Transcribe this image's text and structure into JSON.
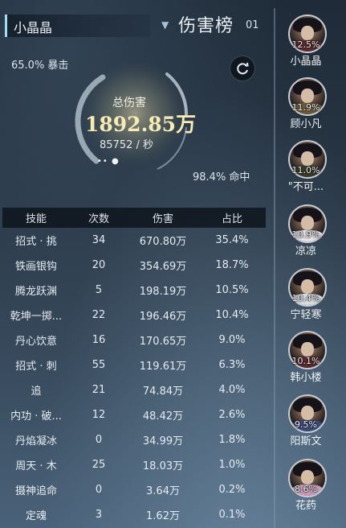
{
  "header": {
    "player_name": "小晶晶",
    "title": "伤害榜",
    "title_index": "01"
  },
  "summary": {
    "crit_rate": "65.0% 暴击",
    "total_label": "总伤害",
    "total_value": "1892.85万",
    "dps": "85752 / 秒",
    "hit_rate": "98.4% 命中"
  },
  "table": {
    "headers": [
      "技能",
      "次数",
      "伤害",
      "占比"
    ],
    "rows": [
      {
        "name": "招式 · 挑",
        "count": "34",
        "damage": "670.80万",
        "percent": "35.4%"
      },
      {
        "name": "铁画银钩",
        "count": "20",
        "damage": "354.69万",
        "percent": "18.7%"
      },
      {
        "name": "腾龙跃渊",
        "count": "5",
        "damage": "198.19万",
        "percent": "10.5%"
      },
      {
        "name": "乾坤一掷...",
        "count": "22",
        "damage": "196.46万",
        "percent": "10.4%"
      },
      {
        "name": "丹心饮意",
        "count": "16",
        "damage": "170.65万",
        "percent": "9.0%"
      },
      {
        "name": "招式 · 刺",
        "count": "55",
        "damage": "119.61万",
        "percent": "6.3%"
      },
      {
        "name": "追",
        "count": "21",
        "damage": "74.84万",
        "percent": "4.0%"
      },
      {
        "name": "内功 · 破...",
        "count": "12",
        "damage": "48.42万",
        "percent": "2.6%"
      },
      {
        "name": "丹焰凝冰",
        "count": "0",
        "damage": "34.99万",
        "percent": "1.8%"
      },
      {
        "name": "周天 · 木",
        "count": "25",
        "damage": "18.03万",
        "percent": "1.0%"
      },
      {
        "name": "摄神追命",
        "count": "0",
        "damage": "3.64万",
        "percent": "0.2%"
      },
      {
        "name": "定魂",
        "count": "3",
        "damage": "1.62万",
        "percent": "0.1%"
      }
    ]
  },
  "ranking": [
    {
      "name": "小晶晶",
      "percent": "12.5%",
      "robe": "#5a2a2e"
    },
    {
      "name": "顾小凡",
      "percent": "11.9%",
      "robe": "#6b5a3a"
    },
    {
      "name": "\"不可...",
      "percent": "11.0%",
      "robe": "#3a3a2a"
    },
    {
      "name": "凉凉",
      "percent": "10.9%",
      "robe": "#e8e4ea"
    },
    {
      "name": "宁轻寒",
      "percent": "10.4%",
      "robe": "#d9dde3"
    },
    {
      "name": "韩小楼",
      "percent": "10.1%",
      "robe": "#5a2a2e"
    },
    {
      "name": "阳斯文",
      "percent": "9.5%",
      "robe": "#3c4a7a"
    },
    {
      "name": "花药",
      "percent": "8.6%",
      "robe": "#c89ab8"
    }
  ],
  "colors": {
    "accent": "#9ee0f2",
    "total_value": "#f6ebb5"
  },
  "icons": {
    "refresh": "refresh-icon",
    "dropdown": "caret-down-icon"
  }
}
